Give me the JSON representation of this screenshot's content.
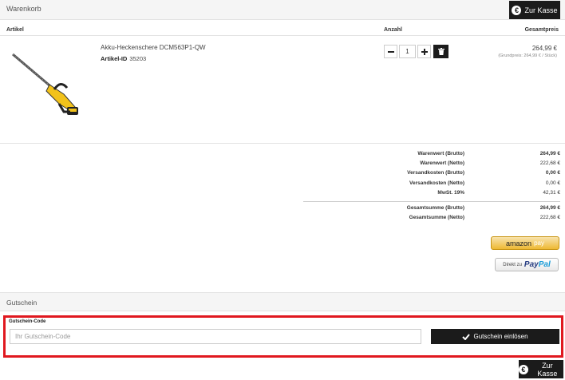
{
  "cart": {
    "title": "Warenkorb",
    "checkout_label": "Zur Kasse",
    "columns": {
      "article": "Artikel",
      "quantity": "Anzahl",
      "total": "Gesamtpreis"
    }
  },
  "item": {
    "name": "Akku-Heckenschere DCM563P1-QW",
    "id_label": "Artikel-ID",
    "id_value": "35203",
    "quantity": "1",
    "price": "264,99 €",
    "base_price": "(Grundpreis: 264,99 € / Stück)"
  },
  "summary": [
    {
      "label": "Warenwert (Brutto)",
      "value": "264,99 €",
      "bold": true
    },
    {
      "label": "Warenwert (Netto)",
      "value": "222,68 €",
      "bold": false
    },
    {
      "label": "Versandkosten (Brutto)",
      "value": "0,00 €",
      "bold": true
    },
    {
      "label": "Versandkosten (Netto)",
      "value": "0,00 €",
      "bold": false
    },
    {
      "label": "MwSt. 19%",
      "value": "42,31 €",
      "bold": false
    }
  ],
  "totals": [
    {
      "label": "Gesamtsumme (Brutto)",
      "value": "264,99 €",
      "bold": true
    },
    {
      "label": "Gesamtsumme (Netto)",
      "value": "222,68 €",
      "bold": false
    }
  ],
  "payment": {
    "amazon_word": "amazon",
    "amazon_pay": "pay",
    "paypal_prefix": "Direkt zu",
    "paypal_pay": "Pay",
    "paypal_pal": "Pal"
  },
  "voucher": {
    "section_title": "Gutschein",
    "label": "Gutschein-Code",
    "placeholder": "Ihr Gutschein-Code",
    "button_label": "Gutschein einlösen"
  },
  "colors": {
    "accent_dark": "#1b1b1b",
    "highlight_red": "#e0181f",
    "amazon_yellow": "#eeb933"
  },
  "icons": [
    "euro-icon",
    "minus-icon",
    "plus-icon",
    "trash-icon",
    "checkmark-icon"
  ]
}
